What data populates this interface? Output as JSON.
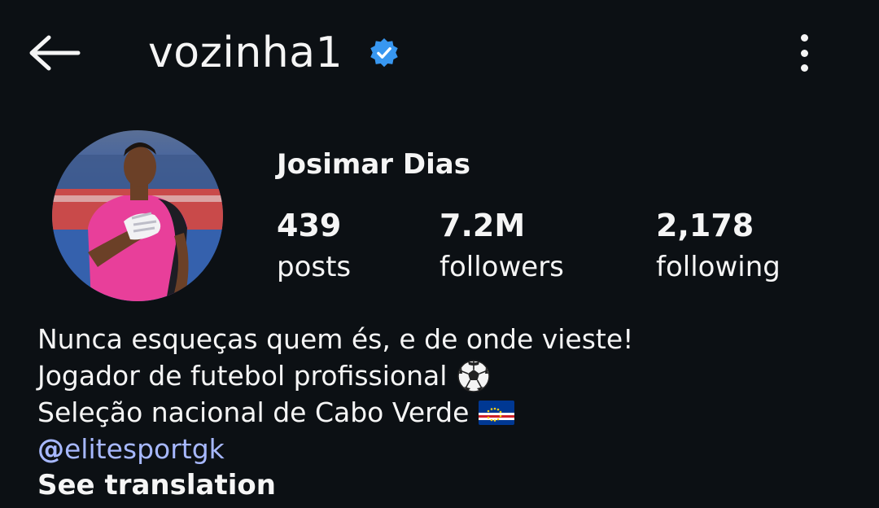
{
  "header": {
    "username": "vozinha1",
    "verified": true,
    "back_icon": "arrow-left-icon",
    "more_icon": "more-vertical-icon",
    "accent_color": "#3897f0"
  },
  "profile": {
    "full_name": "Josimar Dias",
    "avatar": "profile-photo-goalkeeper",
    "stats": [
      {
        "value": "439",
        "label": "posts"
      },
      {
        "value": "7.2M",
        "label": "followers"
      },
      {
        "value": "2,178",
        "label": "following"
      }
    ]
  },
  "bio": {
    "line1": "Nunca esqueças quem és, e de onde vieste!",
    "line2": "Jogador de futebol profissional",
    "line2_emoji": "soccer-ball-icon",
    "line3": "Seleção nacional de Cabo Verde",
    "line3_emoji": "cape-verde-flag-icon",
    "link_prefix": "@",
    "link_handle": "elitesportgk",
    "link_icon": "threads-icon",
    "link_color": "#a7b8ff",
    "see_translation": "See translation"
  }
}
